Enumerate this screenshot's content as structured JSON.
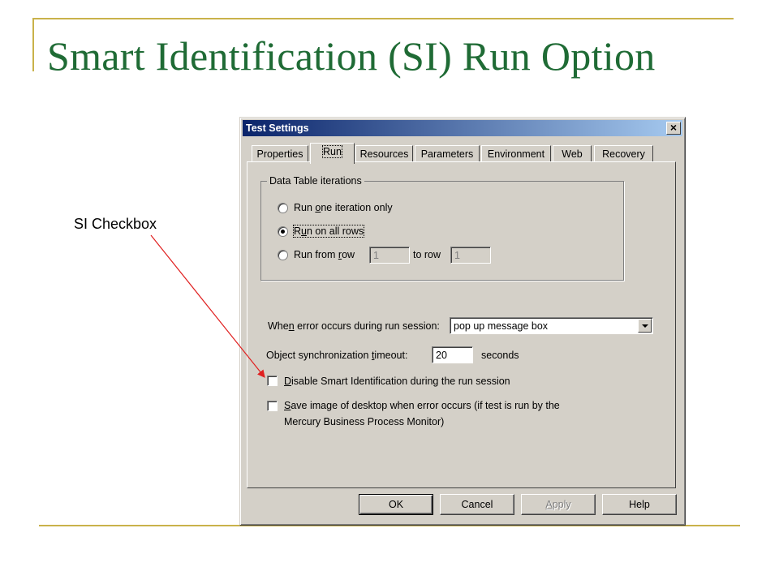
{
  "slide": {
    "title": "Smart Identification (SI) Run Option",
    "callout": "SI Checkbox",
    "accent_color": "#c9b24a",
    "title_color": "#1f6b35"
  },
  "dialog": {
    "title": "Test Settings",
    "close_icon": "close-icon",
    "tabs": [
      {
        "label": "Properties"
      },
      {
        "label": "Run",
        "active": true
      },
      {
        "label": "Resources"
      },
      {
        "label": "Parameters"
      },
      {
        "label": "Environment"
      },
      {
        "label": "Web"
      },
      {
        "label": "Recovery"
      }
    ],
    "iterations": {
      "group_label": "Data Table iterations",
      "options": [
        {
          "label_pre": "Run ",
          "label_u": "o",
          "label_post": "ne iteration only",
          "selected": false
        },
        {
          "label_pre": "R",
          "label_u": "u",
          "label_post": "n on all rows",
          "selected": true
        },
        {
          "label_pre": "Run from ",
          "label_u": "r",
          "label_post": "ow",
          "selected": false
        }
      ],
      "from_row": "1",
      "to_row_label": "to row",
      "to_row": "1"
    },
    "error": {
      "label_pre": "Whe",
      "label_u": "n",
      "label_post": " error occurs during run session:",
      "selected": "pop up message box"
    },
    "sync": {
      "label_pre": "Object synchronization ",
      "label_u": "t",
      "label_post": "imeout:",
      "value": "20",
      "units": "seconds"
    },
    "disable_si": {
      "label_u": "D",
      "label_post": "isable Smart Identification during the run session",
      "checked": false
    },
    "save_image": {
      "label_u": "S",
      "label_post": "ave image of desktop when error occurs (if test is run by the",
      "label_line2": "Mercury Business Process Monitor)",
      "checked": false
    },
    "buttons": {
      "ok": "OK",
      "cancel": "Cancel",
      "apply_u": "A",
      "apply_post": "pply",
      "help": "Help"
    }
  }
}
